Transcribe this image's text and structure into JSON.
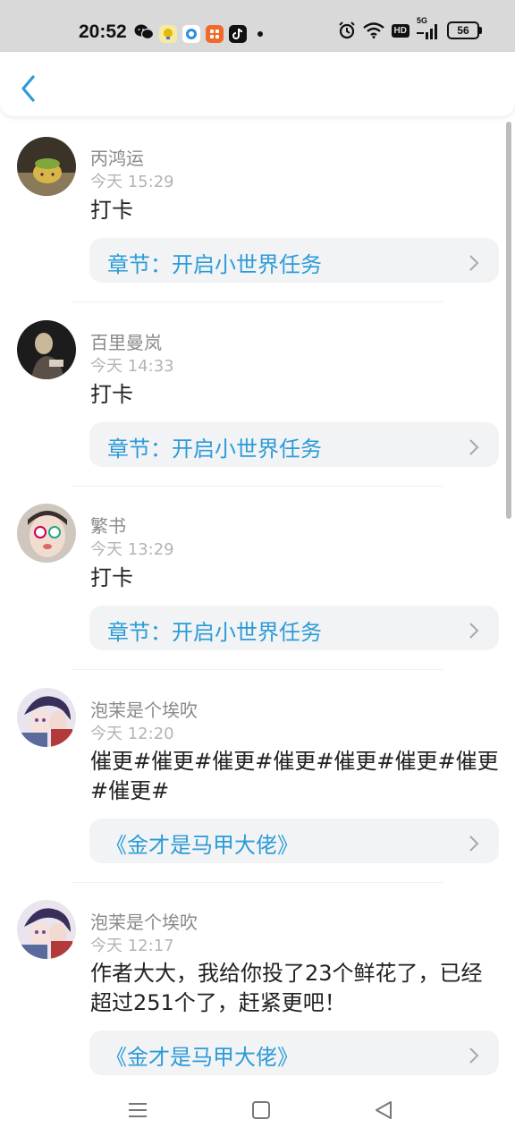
{
  "status_bar": {
    "time": "20:52",
    "left_icons": [
      "wechat-icon",
      "yellow-app-icon",
      "blue-app-icon",
      "orange-app-icon",
      "tiktok-icon"
    ],
    "battery": "56",
    "network": "5G",
    "hd": "HD"
  },
  "header": {
    "back_icon": "chevron-left-icon"
  },
  "comments": [
    {
      "name": "丙鸿运",
      "time": "今天 15:29",
      "content": "打卡",
      "card": "章节：开启小世界任务"
    },
    {
      "name": "百里曼岚",
      "time": "今天 14:33",
      "content": "打卡",
      "card": "章节：开启小世界任务"
    },
    {
      "name": "繁书",
      "time": "今天 13:29",
      "content": "打卡",
      "card": "章节：开启小世界任务"
    },
    {
      "name": "泡茉是个埃吹",
      "time": "今天 12:20",
      "content": "催更#催更#催更#催更#催更#催更#催更#催更#",
      "card": "《金才是马甲大佬》"
    },
    {
      "name": "泡茉是个埃吹",
      "time": "今天 12:17",
      "content": "作者大大，我给你投了23个鲜花了，已经超过251个了，赶紧更吧！",
      "card": "《金才是马甲大佬》"
    }
  ],
  "colors": {
    "accent": "#2c9bd8",
    "card_bg": "#f2f3f5",
    "name": "#8a8a8a",
    "time": "#b4b4b4"
  },
  "system_nav": [
    "menu-icon",
    "home-icon",
    "back-triangle-icon"
  ]
}
